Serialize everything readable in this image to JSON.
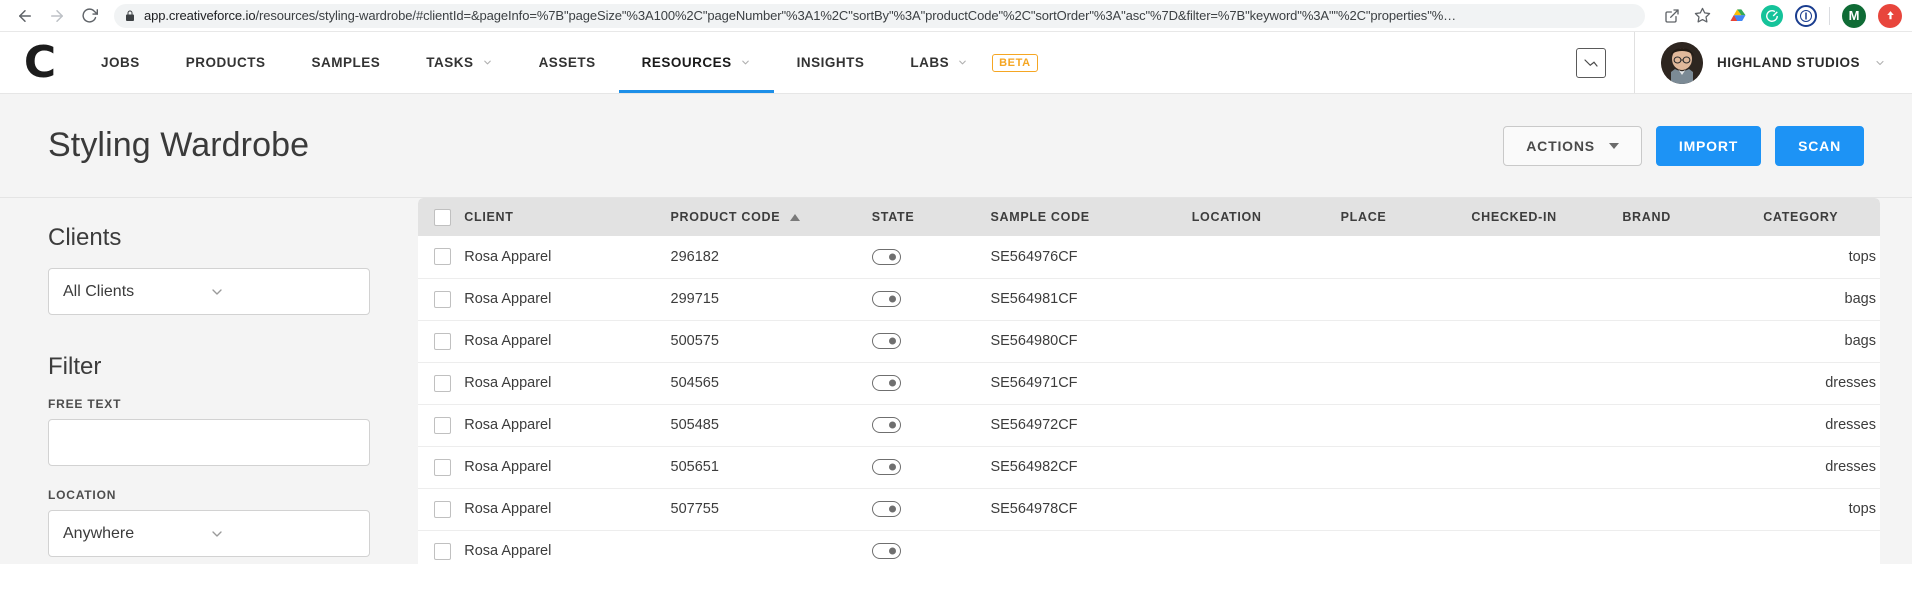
{
  "browser": {
    "url_host": "app.creativeforce.io",
    "url_path": "/resources/styling-wardrobe/#clientId=&pageInfo=%7B\"pageSize\"%3A100%2C\"pageNumber\"%3A1%2C\"sortBy\"%3A\"productCode\"%2C\"sortOrder\"%3A\"asc\"%7D&filter=%7B\"keyword\"%3A\"\"%2C\"properties\"%…",
    "back_icon": "back-arrow-icon",
    "forward_icon": "forward-arrow-icon",
    "reload_icon": "reload-icon",
    "lock_icon": "lock-icon",
    "share_icon": "share-icon",
    "bookmark_icon": "star-icon",
    "extensions": [
      {
        "name": "google-drive-extension-icon",
        "color": "#fbbc04"
      },
      {
        "name": "grammarly-extension-icon",
        "color": "#15c39a"
      },
      {
        "name": "onepassword-extension-icon",
        "color": "#1a73e8"
      }
    ],
    "profile_initial": "M",
    "update_icon": "update-available-icon"
  },
  "nav": {
    "logo": "creativeforce-logo",
    "items": [
      {
        "label": "JOBS",
        "has_caret": false,
        "active": false
      },
      {
        "label": "PRODUCTS",
        "has_caret": false,
        "active": false
      },
      {
        "label": "SAMPLES",
        "has_caret": false,
        "active": false
      },
      {
        "label": "TASKS",
        "has_caret": true,
        "active": false
      },
      {
        "label": "ASSETS",
        "has_caret": false,
        "active": false
      },
      {
        "label": "RESOURCES",
        "has_caret": true,
        "active": true
      },
      {
        "label": "INSIGHTS",
        "has_caret": false,
        "active": false
      },
      {
        "label": "LABS",
        "has_caret": true,
        "active": false
      }
    ],
    "beta_badge": "BETA",
    "feedback_icon": "feedback-icon",
    "user_name": "HIGHLAND STUDIOS",
    "user_caret_icon": "chevron-down-icon",
    "accent_color": "#1d8fe8",
    "beta_color": "#f5a623"
  },
  "page": {
    "title": "Styling Wardrobe",
    "actions_label": "ACTIONS",
    "import_label": "IMPORT",
    "scan_label": "SCAN",
    "primary_color": "#1d93f5"
  },
  "sidebar": {
    "clients_heading": "Clients",
    "clients_value": "All Clients",
    "filter_heading": "Filter",
    "free_text_label": "FREE TEXT",
    "free_text_value": "",
    "free_text_placeholder": "",
    "location_label": "LOCATION",
    "location_value": "Anywhere"
  },
  "table": {
    "columns": [
      "CLIENT",
      "PRODUCT CODE",
      "STATE",
      "SAMPLE CODE",
      "LOCATION",
      "PLACE",
      "CHECKED-IN",
      "BRAND",
      "CATEGORY"
    ],
    "sorted_column": "PRODUCT CODE",
    "sort_direction": "asc",
    "rows": [
      {
        "client": "Rosa Apparel",
        "product_code": "296182",
        "state": "off",
        "sample_code": "SE564976CF",
        "location": "",
        "place": "",
        "checked_in": "",
        "brand": "",
        "category": "tops"
      },
      {
        "client": "Rosa Apparel",
        "product_code": "299715",
        "state": "off",
        "sample_code": "SE564981CF",
        "location": "",
        "place": "",
        "checked_in": "",
        "brand": "",
        "category": "bags"
      },
      {
        "client": "Rosa Apparel",
        "product_code": "500575",
        "state": "off",
        "sample_code": "SE564980CF",
        "location": "",
        "place": "",
        "checked_in": "",
        "brand": "",
        "category": "bags"
      },
      {
        "client": "Rosa Apparel",
        "product_code": "504565",
        "state": "off",
        "sample_code": "SE564971CF",
        "location": "",
        "place": "",
        "checked_in": "",
        "brand": "",
        "category": "dresses"
      },
      {
        "client": "Rosa Apparel",
        "product_code": "505485",
        "state": "off",
        "sample_code": "SE564972CF",
        "location": "",
        "place": "",
        "checked_in": "",
        "brand": "",
        "category": "dresses"
      },
      {
        "client": "Rosa Apparel",
        "product_code": "505651",
        "state": "off",
        "sample_code": "SE564982CF",
        "location": "",
        "place": "",
        "checked_in": "",
        "brand": "",
        "category": "dresses"
      },
      {
        "client": "Rosa Apparel",
        "product_code": "507755",
        "state": "off",
        "sample_code": "SE564978CF",
        "location": "",
        "place": "",
        "checked_in": "",
        "brand": "",
        "category": "tops"
      },
      {
        "client": "Rosa Apparel",
        "product_code": "",
        "state": "off",
        "sample_code": "",
        "location": "",
        "place": "",
        "checked_in": "",
        "brand": "",
        "category": ""
      }
    ]
  }
}
